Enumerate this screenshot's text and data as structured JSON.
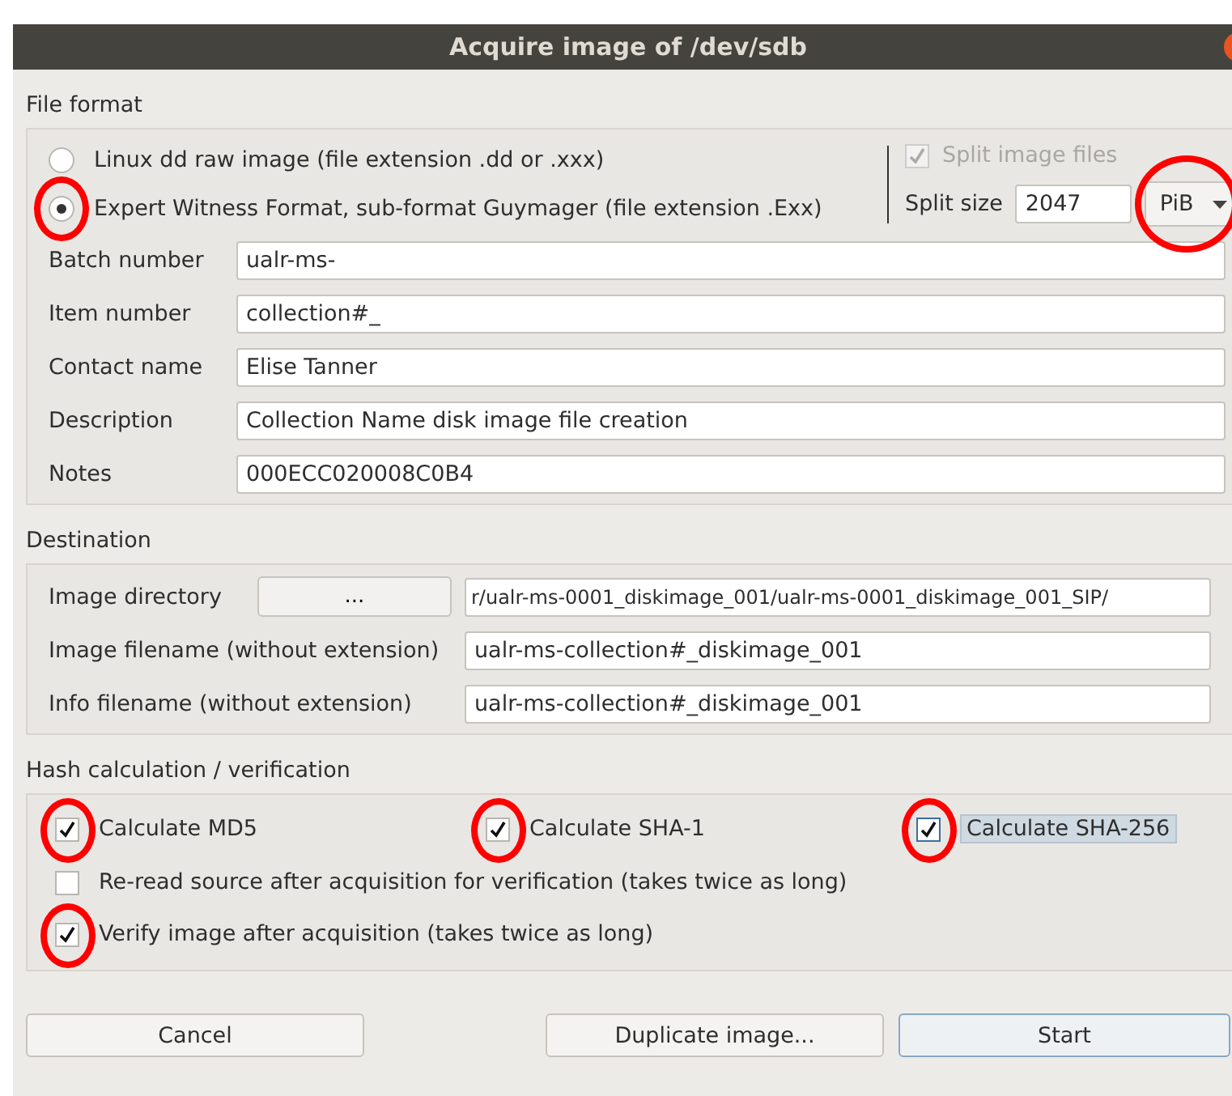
{
  "window": {
    "title": "Acquire image of /dev/sdb"
  },
  "file_format": {
    "label": "File format",
    "formats": [
      {
        "label": "Linux dd raw image (file extension .dd or .xxx)",
        "selected": false,
        "circled": false
      },
      {
        "label": "Expert Witness Format, sub-format Guymager (file extension .Exx)",
        "selected": true,
        "circled": true
      }
    ],
    "split_files": {
      "label": "Split image files",
      "checked": true,
      "disabled": true
    },
    "split_size": {
      "label": "Split size",
      "value": "2047"
    },
    "split_unit": {
      "value": "PiB",
      "circled": true
    },
    "fields": [
      {
        "label": "Batch number",
        "value": "ualr-ms-"
      },
      {
        "label": "Item number",
        "value": "collection#_"
      },
      {
        "label": "Contact name",
        "value": "Elise Tanner"
      },
      {
        "label": "Description",
        "value": "Collection Name disk image file creation"
      },
      {
        "label": "Notes",
        "value": "000ECC020008C0B4"
      }
    ]
  },
  "destination": {
    "label": "Destination",
    "fields": [
      {
        "label": "Image directory",
        "button": "...",
        "value": "r/ualr-ms-0001_diskimage_001/ualr-ms-0001_diskimage_001_SIP/"
      },
      {
        "label": "Image filename (without extension)",
        "value": "ualr-ms-collection#_diskimage_001"
      },
      {
        "label": "Info filename (without extension)",
        "value": "ualr-ms-collection#_diskimage_001"
      }
    ]
  },
  "hash": {
    "label": "Hash calculation / verification",
    "options": [
      {
        "label": "Calculate MD5",
        "checked": true,
        "circled": true,
        "focused": false
      },
      {
        "label": "Calculate SHA-1",
        "checked": true,
        "circled": true,
        "focused": false
      },
      {
        "label": "Calculate SHA-256",
        "checked": true,
        "circled": true,
        "focused": true
      },
      {
        "label": "Re-read source after acquisition for verification (takes twice as long)",
        "checked": false,
        "circled": false,
        "focused": false
      },
      {
        "label": "Verify image after acquisition (takes twice as long)",
        "checked": true,
        "circled": true,
        "focused": false
      }
    ]
  },
  "buttons": [
    {
      "label": "Cancel",
      "default": false
    },
    {
      "label": "Duplicate image...",
      "default": false
    },
    {
      "label": "Start",
      "default": true
    }
  ]
}
